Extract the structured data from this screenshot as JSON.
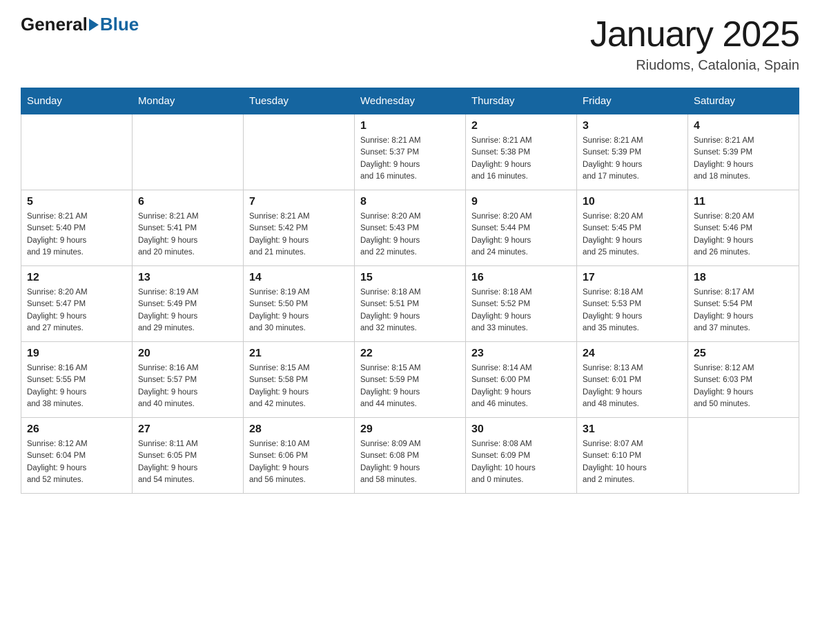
{
  "header": {
    "logo_general": "General",
    "logo_blue": "Blue",
    "title": "January 2025",
    "subtitle": "Riudoms, Catalonia, Spain"
  },
  "days_of_week": [
    "Sunday",
    "Monday",
    "Tuesday",
    "Wednesday",
    "Thursday",
    "Friday",
    "Saturday"
  ],
  "weeks": [
    [
      {
        "day": "",
        "info": ""
      },
      {
        "day": "",
        "info": ""
      },
      {
        "day": "",
        "info": ""
      },
      {
        "day": "1",
        "info": "Sunrise: 8:21 AM\nSunset: 5:37 PM\nDaylight: 9 hours\nand 16 minutes."
      },
      {
        "day": "2",
        "info": "Sunrise: 8:21 AM\nSunset: 5:38 PM\nDaylight: 9 hours\nand 16 minutes."
      },
      {
        "day": "3",
        "info": "Sunrise: 8:21 AM\nSunset: 5:39 PM\nDaylight: 9 hours\nand 17 minutes."
      },
      {
        "day": "4",
        "info": "Sunrise: 8:21 AM\nSunset: 5:39 PM\nDaylight: 9 hours\nand 18 minutes."
      }
    ],
    [
      {
        "day": "5",
        "info": "Sunrise: 8:21 AM\nSunset: 5:40 PM\nDaylight: 9 hours\nand 19 minutes."
      },
      {
        "day": "6",
        "info": "Sunrise: 8:21 AM\nSunset: 5:41 PM\nDaylight: 9 hours\nand 20 minutes."
      },
      {
        "day": "7",
        "info": "Sunrise: 8:21 AM\nSunset: 5:42 PM\nDaylight: 9 hours\nand 21 minutes."
      },
      {
        "day": "8",
        "info": "Sunrise: 8:20 AM\nSunset: 5:43 PM\nDaylight: 9 hours\nand 22 minutes."
      },
      {
        "day": "9",
        "info": "Sunrise: 8:20 AM\nSunset: 5:44 PM\nDaylight: 9 hours\nand 24 minutes."
      },
      {
        "day": "10",
        "info": "Sunrise: 8:20 AM\nSunset: 5:45 PM\nDaylight: 9 hours\nand 25 minutes."
      },
      {
        "day": "11",
        "info": "Sunrise: 8:20 AM\nSunset: 5:46 PM\nDaylight: 9 hours\nand 26 minutes."
      }
    ],
    [
      {
        "day": "12",
        "info": "Sunrise: 8:20 AM\nSunset: 5:47 PM\nDaylight: 9 hours\nand 27 minutes."
      },
      {
        "day": "13",
        "info": "Sunrise: 8:19 AM\nSunset: 5:49 PM\nDaylight: 9 hours\nand 29 minutes."
      },
      {
        "day": "14",
        "info": "Sunrise: 8:19 AM\nSunset: 5:50 PM\nDaylight: 9 hours\nand 30 minutes."
      },
      {
        "day": "15",
        "info": "Sunrise: 8:18 AM\nSunset: 5:51 PM\nDaylight: 9 hours\nand 32 minutes."
      },
      {
        "day": "16",
        "info": "Sunrise: 8:18 AM\nSunset: 5:52 PM\nDaylight: 9 hours\nand 33 minutes."
      },
      {
        "day": "17",
        "info": "Sunrise: 8:18 AM\nSunset: 5:53 PM\nDaylight: 9 hours\nand 35 minutes."
      },
      {
        "day": "18",
        "info": "Sunrise: 8:17 AM\nSunset: 5:54 PM\nDaylight: 9 hours\nand 37 minutes."
      }
    ],
    [
      {
        "day": "19",
        "info": "Sunrise: 8:16 AM\nSunset: 5:55 PM\nDaylight: 9 hours\nand 38 minutes."
      },
      {
        "day": "20",
        "info": "Sunrise: 8:16 AM\nSunset: 5:57 PM\nDaylight: 9 hours\nand 40 minutes."
      },
      {
        "day": "21",
        "info": "Sunrise: 8:15 AM\nSunset: 5:58 PM\nDaylight: 9 hours\nand 42 minutes."
      },
      {
        "day": "22",
        "info": "Sunrise: 8:15 AM\nSunset: 5:59 PM\nDaylight: 9 hours\nand 44 minutes."
      },
      {
        "day": "23",
        "info": "Sunrise: 8:14 AM\nSunset: 6:00 PM\nDaylight: 9 hours\nand 46 minutes."
      },
      {
        "day": "24",
        "info": "Sunrise: 8:13 AM\nSunset: 6:01 PM\nDaylight: 9 hours\nand 48 minutes."
      },
      {
        "day": "25",
        "info": "Sunrise: 8:12 AM\nSunset: 6:03 PM\nDaylight: 9 hours\nand 50 minutes."
      }
    ],
    [
      {
        "day": "26",
        "info": "Sunrise: 8:12 AM\nSunset: 6:04 PM\nDaylight: 9 hours\nand 52 minutes."
      },
      {
        "day": "27",
        "info": "Sunrise: 8:11 AM\nSunset: 6:05 PM\nDaylight: 9 hours\nand 54 minutes."
      },
      {
        "day": "28",
        "info": "Sunrise: 8:10 AM\nSunset: 6:06 PM\nDaylight: 9 hours\nand 56 minutes."
      },
      {
        "day": "29",
        "info": "Sunrise: 8:09 AM\nSunset: 6:08 PM\nDaylight: 9 hours\nand 58 minutes."
      },
      {
        "day": "30",
        "info": "Sunrise: 8:08 AM\nSunset: 6:09 PM\nDaylight: 10 hours\nand 0 minutes."
      },
      {
        "day": "31",
        "info": "Sunrise: 8:07 AM\nSunset: 6:10 PM\nDaylight: 10 hours\nand 2 minutes."
      },
      {
        "day": "",
        "info": ""
      }
    ]
  ]
}
